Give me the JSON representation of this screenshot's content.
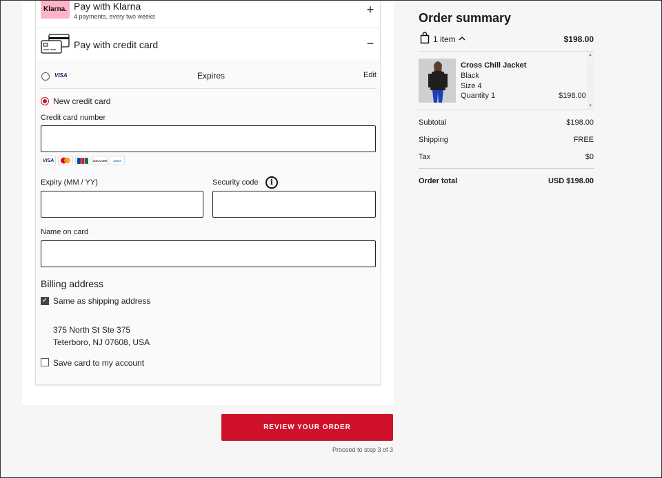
{
  "payment": {
    "klarna": {
      "logo_text": "Klarna.",
      "title": "Pay with Klarna",
      "subtitle": "4 payments, every two weeks",
      "toggle": "+"
    },
    "credit_card": {
      "title": "Pay with credit card",
      "toggle": "−",
      "saved_card": {
        "brand": "VISA",
        "number_mask": "·",
        "expires_label": "Expires",
        "edit_label": "Edit"
      },
      "new_card_label": "New credit card",
      "card_number_label": "Credit card number",
      "card_number_value": "",
      "card_logos": [
        "VISA",
        "MC",
        "JCB",
        "DISCOVER",
        "AMEX"
      ],
      "expiry_label": "Expiry (MM / YY)",
      "expiry_value": "",
      "security_label": "Security code",
      "security_value": "",
      "name_label": "Name on card",
      "name_value": ""
    },
    "billing": {
      "title": "Billing address",
      "same_as_shipping_label": "Same as shipping address",
      "address_line1": "375 North St Ste 375",
      "address_line2": "Teterboro, NJ 07608, USA",
      "save_card_label": "Save card to my account"
    }
  },
  "actions": {
    "review_label": "REVIEW YOUR ORDER",
    "proceed_text": "Proceed to step 3 of 3"
  },
  "summary": {
    "title": "Order summary",
    "items_count": "1 item",
    "items_price": "$198.00",
    "item": {
      "name": "Cross Chill Jacket",
      "color": "Black",
      "size": "Size 4",
      "quantity": "Quantity 1",
      "price": "$198.00"
    },
    "subtotal_label": "Subtotal",
    "subtotal_value": "$198.00",
    "shipping_label": "Shipping",
    "shipping_value": "FREE",
    "tax_label": "Tax",
    "tax_value": "$0",
    "total_label": "Order total",
    "total_value": "USD $198.00"
  },
  "colors": {
    "accent": "#d0112b",
    "klarna_pink": "#ffb3c7"
  }
}
